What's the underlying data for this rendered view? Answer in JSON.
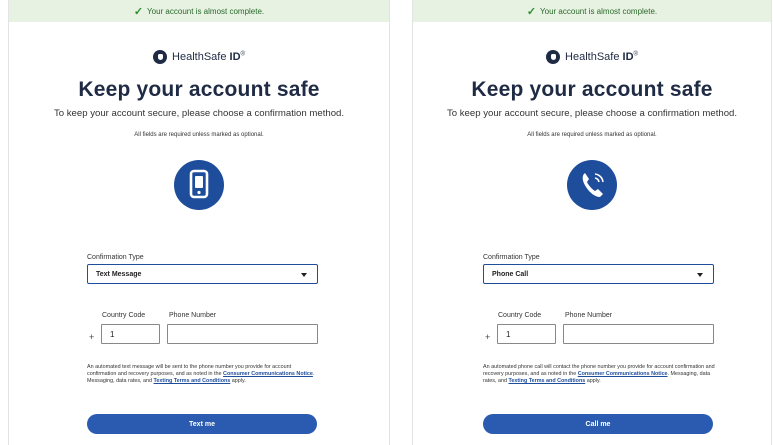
{
  "panels": [
    {
      "banner": "Your account is almost complete.",
      "logo": {
        "text": "HealthSafe",
        "bold": "ID",
        "tm": "®"
      },
      "title": "Keep your account safe",
      "subtitle": "To keep your account secure, please choose a confirmation method.",
      "required_note": "All fields are required unless marked as optional.",
      "icon": "smartphone-icon",
      "confirmation_type_label": "Confirmation Type",
      "confirmation_type_value": "Text Message",
      "country_code_label": "Country Code",
      "country_code_value": "1",
      "phone_number_label": "Phone Number",
      "phone_number_value": "",
      "plus": "+",
      "disclaimer": {
        "pre": "An automated text message will be sent to the phone number you provide for account confirmation and recovery purposes, and as noted in the ",
        "link1": "Consumer Communications Notice",
        "mid": ". Messaging, data rates, and ",
        "link2": "Texting Terms and Conditions",
        "post": " apply."
      },
      "button": "Text me"
    },
    {
      "banner": "Your account is almost complete.",
      "logo": {
        "text": "HealthSafe",
        "bold": "ID",
        "tm": "®"
      },
      "title": "Keep your account safe",
      "subtitle": "To keep your account secure, please choose a confirmation method.",
      "required_note": "All fields are required unless marked as optional.",
      "icon": "phone-handset-icon",
      "confirmation_type_label": "Confirmation Type",
      "confirmation_type_value": "Phone Call",
      "country_code_label": "Country Code",
      "country_code_value": "1",
      "phone_number_label": "Phone Number",
      "phone_number_value": "",
      "plus": "+",
      "disclaimer": {
        "pre": "An automated phone call will contact the phone number you provide for account confirmation and recovery purposes, and as noted in the ",
        "link1": "Consumer Communications Notice",
        "mid": ". Messaging, data rates, and ",
        "link2": "Texting Terms and Conditions",
        "post": " apply."
      },
      "button": "Call me"
    }
  ],
  "colors": {
    "brand_blue": "#1e4d9c",
    "button_blue": "#2a5bb0",
    "banner_bg": "#e7f2e3",
    "banner_text": "#2b6a2b"
  }
}
